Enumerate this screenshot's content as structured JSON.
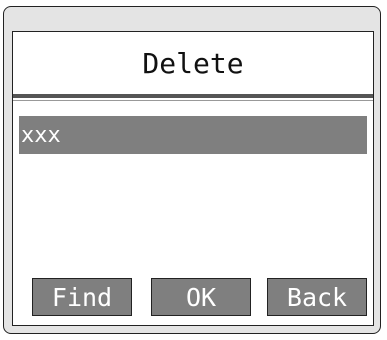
{
  "screen": {
    "title": "Delete"
  },
  "list": {
    "items": [
      {
        "label": "xxx",
        "selected": true
      }
    ]
  },
  "softkeys": {
    "find_label": "Find",
    "ok_label": "OK",
    "back_label": "Back"
  },
  "colors": {
    "highlight": "#7f7f7f",
    "panel": "#e4e4e4",
    "screen": "#ffffff"
  }
}
